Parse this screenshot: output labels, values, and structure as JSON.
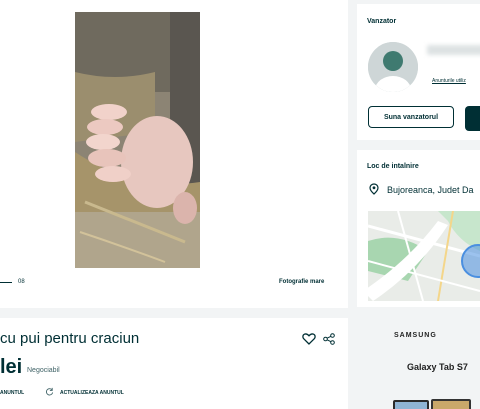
{
  "gallery": {
    "page_counter": "08",
    "fullsize_label": "Fotografie mare",
    "photo_subject": "sow with piglets in a straw pen"
  },
  "seller": {
    "heading": "Vanzator",
    "all_ads_link": "Anunturile utiliz",
    "call_button": "Suna vanzatorul"
  },
  "location": {
    "heading": "Loc de intalnire",
    "text": "Bujoreanca, Judet Da"
  },
  "listing": {
    "title": "cu pui pentru craciun",
    "price": "lei",
    "negotiable": "Negociabil",
    "action_left": "ANUNTUL",
    "action_refresh": "ACTUALIZEAZA ANUNTUL"
  },
  "advert": {
    "brand": "SAMSUNG",
    "product": "Galaxy Tab S7"
  },
  "icons": {
    "favorite": "heart-icon",
    "share": "share-icon",
    "location": "pin-icon",
    "refresh": "refresh-icon"
  },
  "colors": {
    "primary": "#002f34",
    "background": "#f2f4f5",
    "map_water": "#4a8fe0",
    "map_park": "#a8d6b0"
  }
}
